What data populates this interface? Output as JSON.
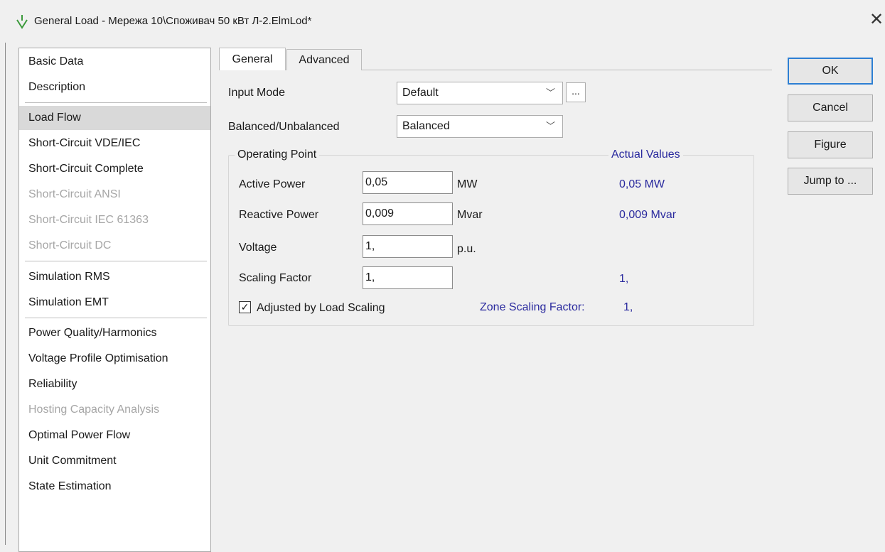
{
  "window": {
    "title": "General Load - Мережа 10\\Споживач 50 кВт Л-2.ElmLod*",
    "icon": "load-arrow-icon",
    "close_glyph": "✕"
  },
  "sidebar": {
    "items": [
      {
        "label": "Basic Data",
        "state": "normal"
      },
      {
        "label": "Description",
        "state": "normal"
      },
      {
        "label": "Load Flow",
        "state": "selected"
      },
      {
        "label": "Short-Circuit VDE/IEC",
        "state": "normal"
      },
      {
        "label": "Short-Circuit Complete",
        "state": "normal"
      },
      {
        "label": "Short-Circuit ANSI",
        "state": "disabled"
      },
      {
        "label": "Short-Circuit IEC 61363",
        "state": "disabled"
      },
      {
        "label": "Short-Circuit DC",
        "state": "disabled"
      },
      {
        "label": "Simulation RMS",
        "state": "normal"
      },
      {
        "label": "Simulation EMT",
        "state": "normal"
      },
      {
        "label": "Power Quality/Harmonics",
        "state": "normal"
      },
      {
        "label": "Voltage Profile Optimisation",
        "state": "normal"
      },
      {
        "label": "Reliability",
        "state": "normal"
      },
      {
        "label": "Hosting Capacity Analysis",
        "state": "disabled"
      },
      {
        "label": "Optimal Power Flow",
        "state": "normal"
      },
      {
        "label": "Unit Commitment",
        "state": "normal"
      },
      {
        "label": "State Estimation",
        "state": "normal"
      }
    ]
  },
  "tabs": [
    {
      "label": "General",
      "active": true
    },
    {
      "label": "Advanced",
      "active": false
    }
  ],
  "form": {
    "input_mode": {
      "label": "Input Mode",
      "value": "Default",
      "more_button": "..."
    },
    "balanced": {
      "label": "Balanced/Unbalanced",
      "value": "Balanced"
    },
    "operating_point": {
      "title": "Operating Point",
      "actual_title": "Actual Values",
      "active_power": {
        "label": "Active Power",
        "value": "0,05",
        "unit": "MW",
        "actual": "0,05 MW"
      },
      "reactive_power": {
        "label": "Reactive Power",
        "value": "0,009",
        "unit": "Mvar",
        "actual": "0,009 Mvar"
      },
      "voltage": {
        "label": "Voltage",
        "value": "1,",
        "unit": "p.u."
      },
      "scaling_factor": {
        "label": "Scaling Factor",
        "value": "1,",
        "actual": "1,"
      },
      "adjusted": {
        "label": "Adjusted by Load Scaling",
        "checked": true
      },
      "zone_scaling": {
        "label": "Zone Scaling Factor:",
        "value": "1,"
      }
    }
  },
  "buttons": {
    "ok": "OK",
    "cancel": "Cancel",
    "figure": "Figure",
    "jump": "Jump to ..."
  },
  "colors": {
    "accent_text": "#2a2a9e",
    "default_button_border": "#2d7fd3",
    "icon_green": "#3c9a3c"
  }
}
